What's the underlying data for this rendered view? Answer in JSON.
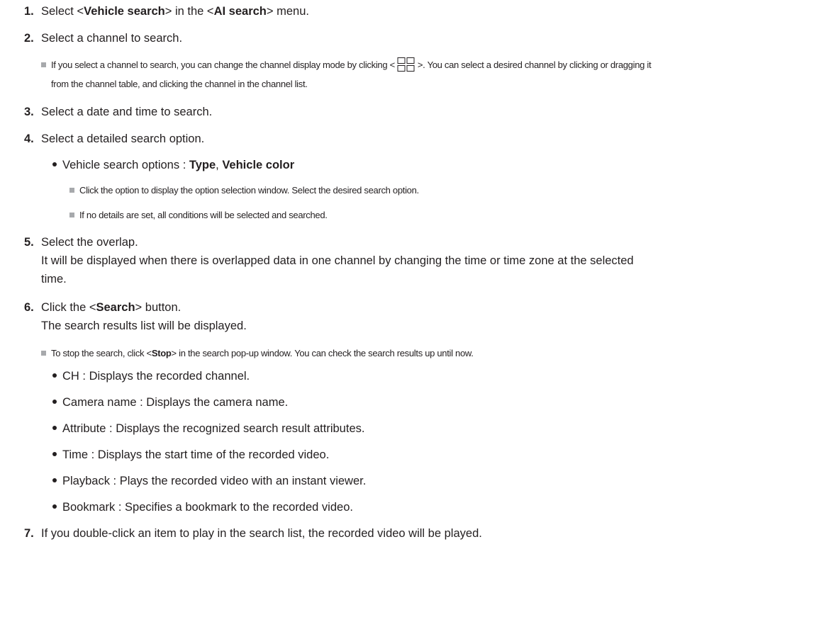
{
  "steps": [
    {
      "num": "1.",
      "t1": "Select <",
      "b1": "Vehicle search",
      "t2": "> in the <",
      "b2": "AI search",
      "t3": "> menu."
    },
    {
      "num": "2.",
      "text": "Select a channel to search."
    },
    {
      "num": "3.",
      "text": "Select a date and time to search."
    },
    {
      "num": "4.",
      "text": "Select a detailed search option."
    },
    {
      "num": "5.",
      "text": "Select the overlap.",
      "cont": "It will be displayed when there is overlapped data in one channel by changing the time or time zone at the selected",
      "cont2": "time."
    },
    {
      "num": "6.",
      "t1": "Click the <",
      "b1": "Search",
      "t2": "> button.",
      "cont": "The search results list will be displayed."
    },
    {
      "num": "7.",
      "text": "If you double-click an item to play in the search list, the recorded video will be played."
    }
  ],
  "notes": {
    "channel_1a": "If you select a channel to search, you can change the channel display mode by clicking <",
    "channel_1b": ">. You can select a desired channel by clicking or dragging it",
    "channel_2": "from the channel table, and clicking the channel in the channel list.",
    "option_1": "Click the option to display the option selection window. Select the desired search option.",
    "option_2": "If no details are set, all conditions will be selected and searched.",
    "stop_a": "To stop the search, click <",
    "stop_b": "Stop",
    "stop_c": "> in the search pop-up window. You can check the search results up until now."
  },
  "vehicle_options": {
    "prefix": "Vehicle search options : ",
    "opt1": "Type",
    "sep": ", ",
    "opt2": "Vehicle color"
  },
  "results": [
    "CH : Displays the recorded channel.",
    "Camera name : Displays the camera name.",
    "Attribute : Displays the recognized search result attributes.",
    "Time : Displays the start time of the recorded video.",
    "Playback : Plays the recorded video with an instant viewer.",
    "Bookmark : Specifies a bookmark to the recorded video."
  ],
  "icons": {
    "bullet": "square-bullet-icon",
    "display_mode": "channel-grid-icon"
  },
  "colors": {
    "text": "#231f20",
    "note_square": "#a7a9ac"
  }
}
